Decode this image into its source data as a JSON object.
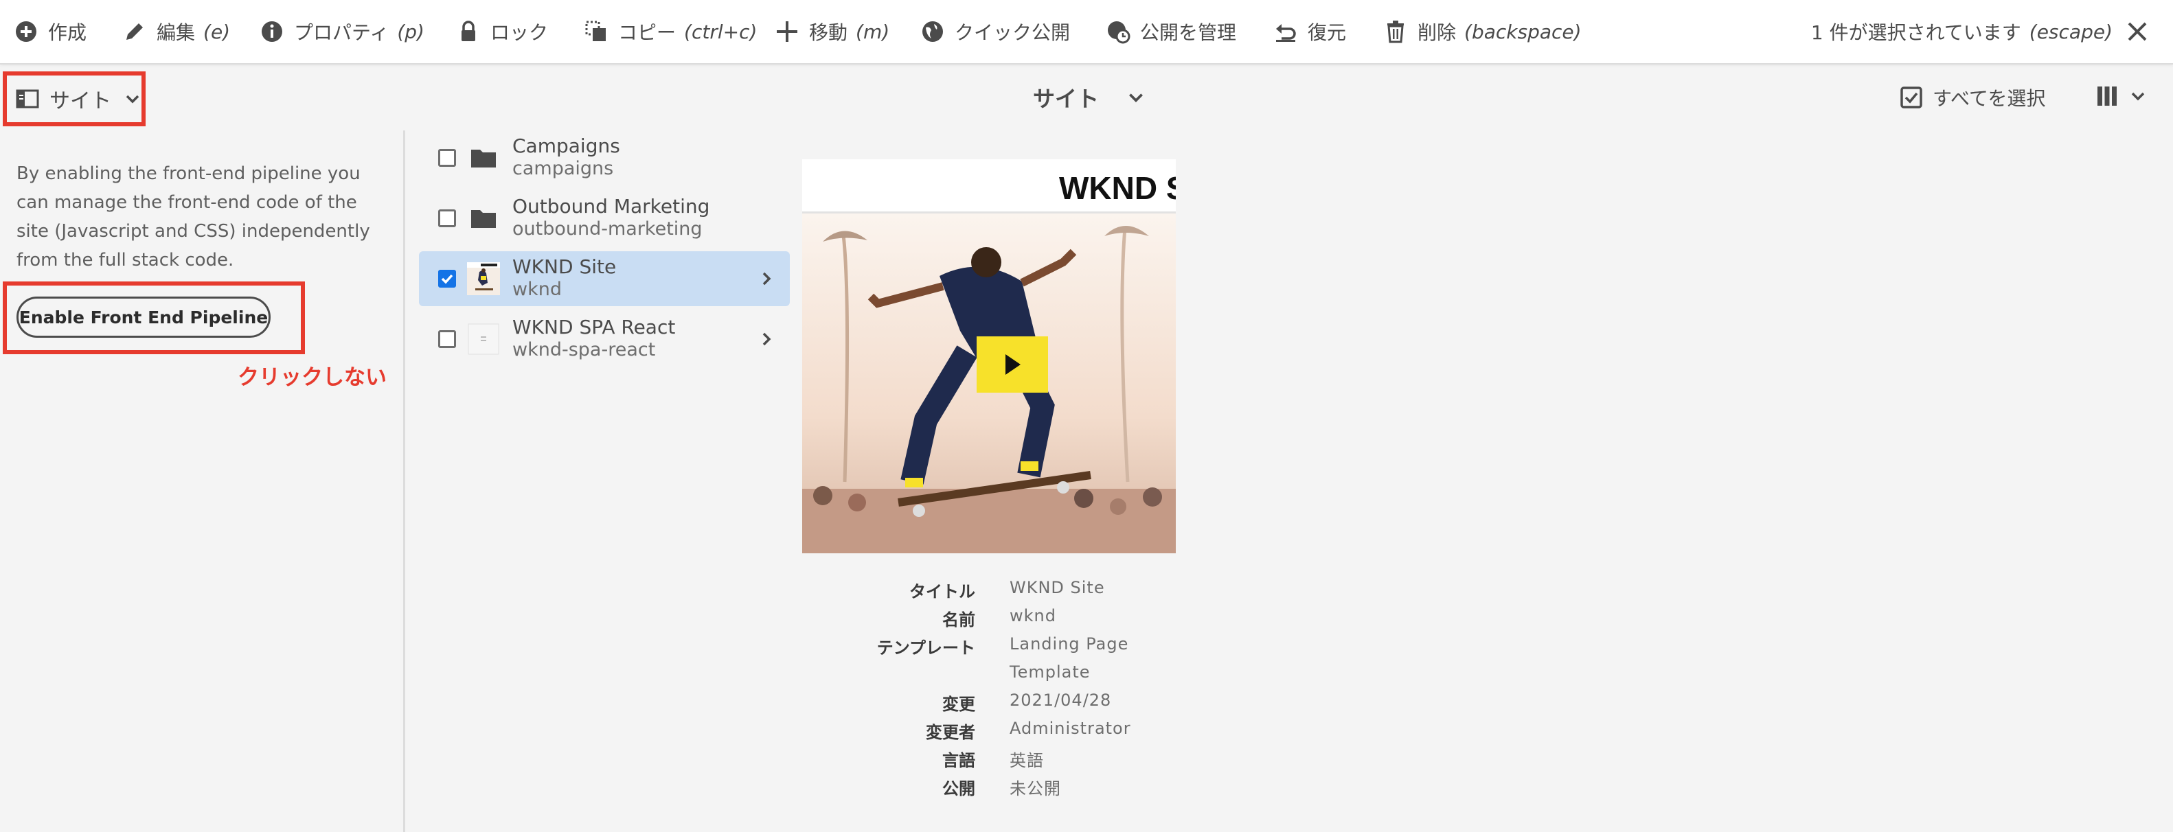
{
  "actionbar": {
    "create": "作成",
    "edit": "編集",
    "edit_hint": "(e)",
    "properties": "プロパティ",
    "properties_hint": "(p)",
    "lock": "ロック",
    "copy": "コピー",
    "copy_hint": "(ctrl+c)",
    "move": "移動",
    "move_hint": "(m)",
    "quick_publish": "クイック公開",
    "manage_publication": "公開を管理",
    "restore": "復元",
    "delete": "削除",
    "delete_hint": "(backspace)",
    "selection_info": "1 件が選択されています",
    "escape_hint": "(escape)"
  },
  "toolbar": {
    "rail_label": "サイト",
    "title": "サイト",
    "select_all": "すべてを選択"
  },
  "rail": {
    "description": "By enabling the front-end pipeline you can manage the front-end code of the site (Javascript and CSS) independently from the full stack code.",
    "pipeline_button": "Enable Front End Pipeline",
    "annotation": "クリックしない"
  },
  "column": {
    "items": [
      {
        "title": "Campaigns",
        "name": "campaigns",
        "type": "folder",
        "selected": false,
        "has_children": false
      },
      {
        "title": "Outbound Marketing",
        "name": "outbound-marketing",
        "type": "folder",
        "selected": false,
        "has_children": false
      },
      {
        "title": "WKND Site",
        "name": "wknd",
        "type": "page",
        "selected": true,
        "has_children": true
      },
      {
        "title": "WKND SPA React",
        "name": "wknd-spa-react",
        "type": "page",
        "selected": false,
        "has_children": true
      }
    ]
  },
  "preview": {
    "banner": "WKND SIT"
  },
  "meta": {
    "title_label": "タイトル",
    "title_value": "WKND Site",
    "name_label": "名前",
    "name_value": "wknd",
    "template_label": "テンプレート",
    "template_value_1": "Landing Page",
    "template_value_2": "Template",
    "modified_label": "変更",
    "modified_value": "2021/04/28",
    "modified_by_label": "変更者",
    "modified_by_value": "Administrator",
    "language_label": "言語",
    "language_value": "英語",
    "published_label": "公開",
    "published_value": "未公開"
  },
  "colors": {
    "accent": "#1473e6",
    "annotation_red": "#e63b2e",
    "selected_row": "#c9ddf3"
  }
}
